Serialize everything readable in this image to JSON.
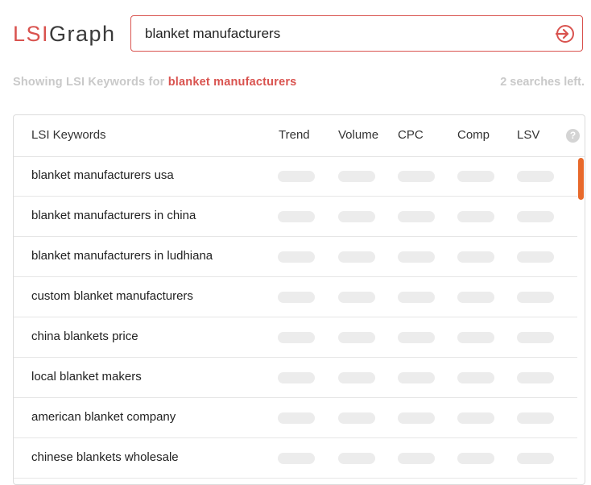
{
  "logo": {
    "part1": "LSI",
    "part2": "Graph"
  },
  "search": {
    "value": "blanket manufacturers",
    "go_icon": "sign-in-arrow-icon"
  },
  "status": {
    "showing_prefix": "Showing LSI Keywords for",
    "keyword": "blanket manufacturers",
    "searches_left": "2 searches left."
  },
  "table": {
    "columns": [
      "LSI Keywords",
      "Trend",
      "Volume",
      "CPC",
      "Comp",
      "LSV"
    ],
    "help_icon": "?",
    "rows": [
      "blanket manufacturers usa",
      "blanket manufacturers in china",
      "blanket manufacturers in ludhiana",
      "custom blanket manufacturers",
      "china blankets price",
      "local blanket makers",
      "american blanket company",
      "chinese blankets wholesale"
    ]
  },
  "colors": {
    "brand_red": "#d9534f",
    "scroll_accent": "#e8692b",
    "placeholder_pill": "#ececec"
  }
}
